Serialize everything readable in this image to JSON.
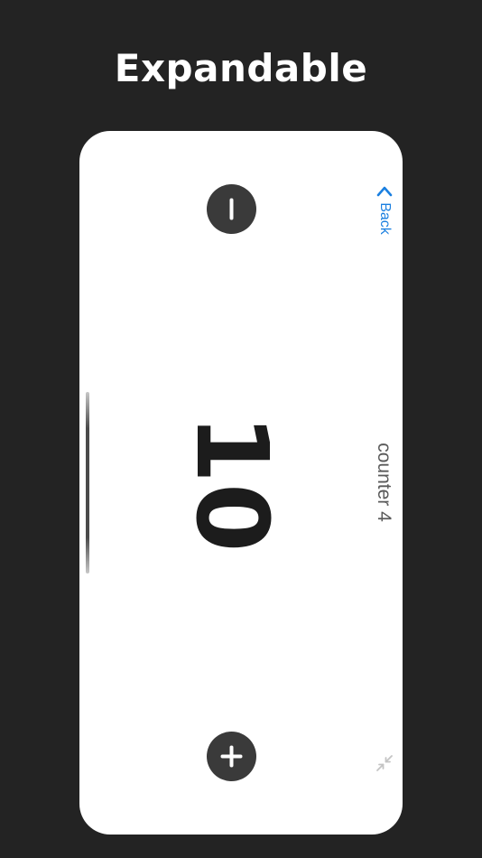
{
  "headline": "Expandable",
  "counter": {
    "value": "10",
    "name": "counter 4"
  },
  "nav": {
    "back_label": "Back"
  },
  "icons": {
    "decrement": "minus-icon",
    "increment": "plus-icon",
    "back": "chevron-left-icon",
    "collapse": "collapse-arrows-icon"
  },
  "colors": {
    "background": "#232323",
    "card": "#ffffff",
    "button": "#3a3a3a",
    "accent": "#1a7fe0",
    "count_text": "#1c1c1c"
  }
}
